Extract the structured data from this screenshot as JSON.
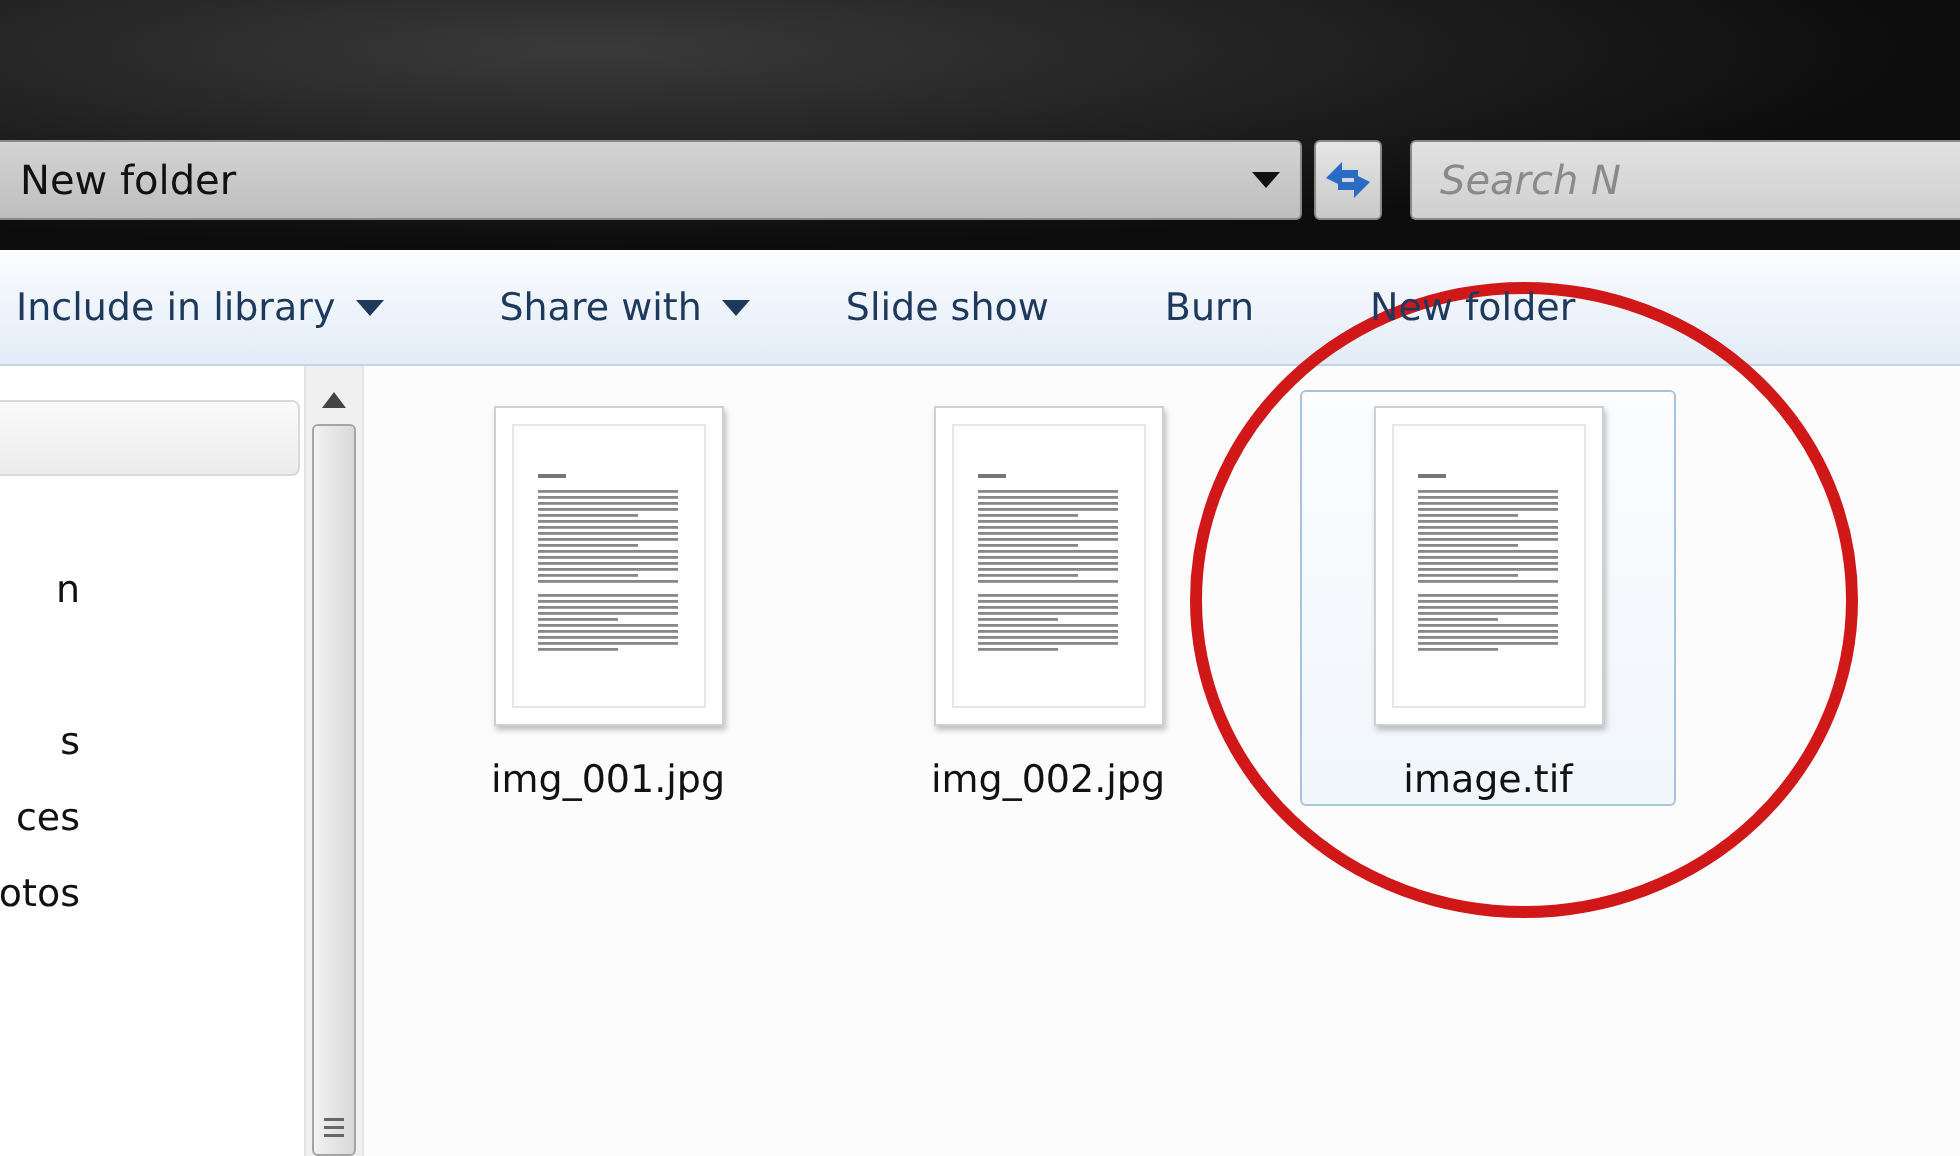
{
  "address_bar": {
    "path": "New folder",
    "search_placeholder": "Search N"
  },
  "toolbar": [
    {
      "label": "Include in library",
      "has_menu": true
    },
    {
      "label": "Share with",
      "has_menu": true
    },
    {
      "label": "Slide show",
      "has_menu": false
    },
    {
      "label": "Burn",
      "has_menu": false
    },
    {
      "label": "New folder",
      "has_menu": false
    }
  ],
  "navigation": {
    "groups": [
      {
        "items": [
          "n"
        ]
      },
      {
        "items": [
          "s",
          "ces",
          "otos"
        ]
      }
    ]
  },
  "files": [
    {
      "name": "img_001.jpg",
      "selected": false
    },
    {
      "name": "img_002.jpg",
      "selected": false
    },
    {
      "name": "image.tif",
      "selected": true
    }
  ],
  "annotation": {
    "kind": "circle"
  }
}
